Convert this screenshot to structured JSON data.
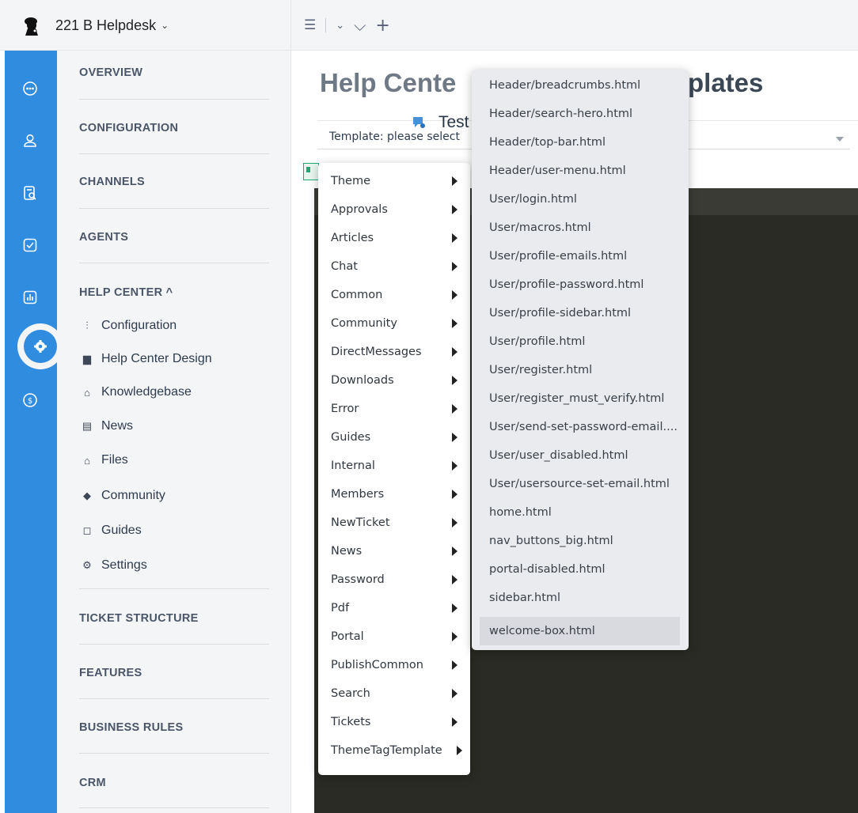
{
  "topbar": {
    "brand_name": "221 B Helpdesk",
    "brand_chevron": "⌄",
    "tools": [
      "☰",
      "⌄",
      "⌵",
      "+"
    ]
  },
  "rail": {
    "icons": [
      "chat-icon",
      "user-icon",
      "search-document-icon",
      "checkbox-icon",
      "report-chart-icon",
      "settings-gear-icon",
      "dollar-icon"
    ],
    "active": "settings-gear-icon"
  },
  "nav": {
    "sections": {
      "overview": "OVERVIEW",
      "configuration": "CONFIGURATION",
      "channels": "CHANNELS",
      "agents": "AGENTS",
      "help_center": "HELP CENTER ^",
      "ticket_structure": "TICKET STRUCTURE",
      "features": "FEATURES",
      "business_rules": "BUSINESS RULES",
      "crm": "CRM"
    },
    "help_center_items": [
      {
        "label": "Configuration",
        "icon": "⫶"
      },
      {
        "label": "Help Center Design",
        "icon": "▆"
      },
      {
        "label": "Knowledgebase",
        "icon": "⌂"
      },
      {
        "label": "News",
        "icon": "▤"
      },
      {
        "label": "Files",
        "icon": "⌂"
      },
      {
        "label": "Community",
        "icon": "◆"
      },
      {
        "label": "Guides",
        "icon": "◻"
      },
      {
        "label": "Settings",
        "icon": "⚙"
      }
    ]
  },
  "main": {
    "title_prefix": "Help Cente",
    "title_suffix": "plates",
    "template_label": "Template:  please select",
    "test_brand": "Test brand"
  },
  "menu1": {
    "items": [
      "Theme",
      "Approvals",
      "Articles",
      "Chat",
      "Common",
      "Community",
      "DirectMessages",
      "Downloads",
      "Error",
      "Guides",
      "Internal",
      "Members",
      "NewTicket",
      "News",
      "Password",
      "Pdf",
      "Portal",
      "PublishCommon",
      "Search",
      "Tickets",
      "ThemeTagTemplate"
    ]
  },
  "menu2": {
    "items": [
      "Header/breadcrumbs.html",
      "Header/search-hero.html",
      "Header/top-bar.html",
      "Header/user-menu.html",
      "User/login.html",
      "User/macros.html",
      "User/profile-emails.html",
      "User/profile-password.html",
      "User/profile-sidebar.html",
      "User/profile.html",
      "User/register.html",
      "User/register_must_verify.html",
      "User/send-set-password-email....",
      "User/user_disabled.html",
      "User/usersource-set-email.html",
      "home.html",
      "nav_buttons_big.html",
      "portal-disabled.html",
      "sidebar.html",
      "welcome-box.html"
    ],
    "highlighted": "welcome-box.html"
  }
}
